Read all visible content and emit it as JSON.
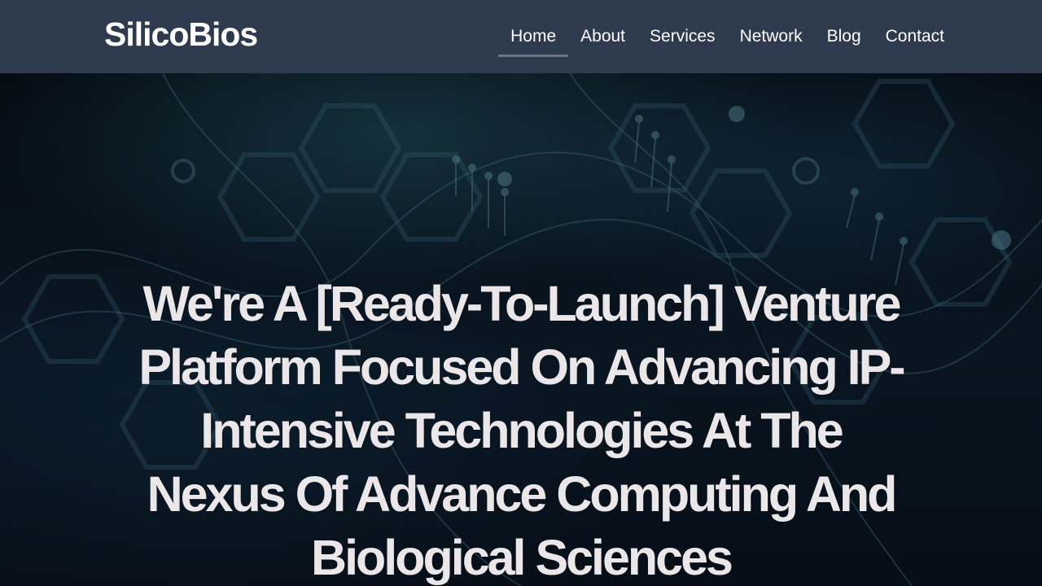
{
  "brand": {
    "name": "SilicoBios"
  },
  "nav": {
    "items": [
      {
        "label": "Home",
        "active": true
      },
      {
        "label": "About",
        "active": false
      },
      {
        "label": "Services",
        "active": false
      },
      {
        "label": "Network",
        "active": false
      },
      {
        "label": "Blog",
        "active": false
      },
      {
        "label": "Contact",
        "active": false
      }
    ]
  },
  "hero": {
    "headline": "We're A [Ready-To-Launch] Venture Platform Focused On Advancing IP-Intensive Technologies At The Nexus Of Advance Computing And Biological Sciences"
  },
  "colors": {
    "navbar_bg": "#2e3a4d",
    "headline_text": "#ebe6e8",
    "nav_active_underline": "#6f7783",
    "hero_bg": "#0b1a28"
  }
}
